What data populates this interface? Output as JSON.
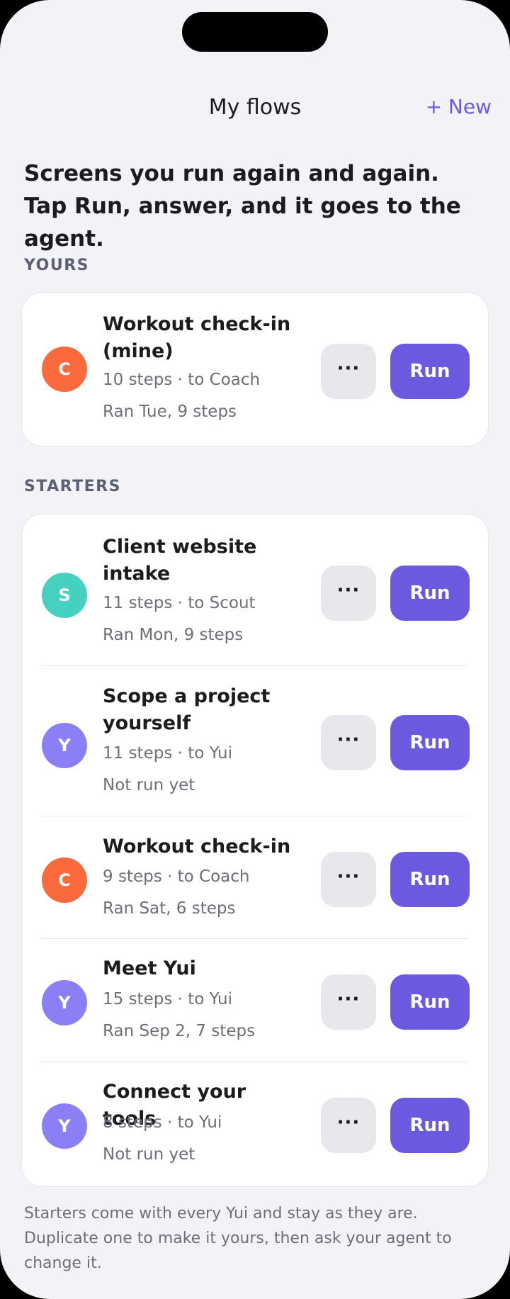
{
  "header": {
    "title": "My flows",
    "new_label": "+ New"
  },
  "intro": "Screens you run again and again. Tap Run, answer, and it goes to the agent.",
  "sections": {
    "yours": "YOURS",
    "starters": "STARTERS"
  },
  "yours_items": [
    {
      "initial": "C",
      "color": "#fa6a3c",
      "title": "Workout check-in (mine)",
      "steps": "10 steps · to Coach",
      "last_run": "Ran Tue, 9 steps",
      "more_icon": "···",
      "run_label": "Run"
    }
  ],
  "starter_items": [
    {
      "initial": "S",
      "color": "#45d0bf",
      "title": "Client website intake",
      "steps": "11 steps · to Scout",
      "last_run": "Ran Mon, 9 steps",
      "more_icon": "···",
      "run_label": "Run"
    },
    {
      "initial": "Y",
      "color": "#8b7ff5",
      "title": "Scope a project yourself",
      "steps": "11 steps · to Yui",
      "last_run": "Not run yet",
      "more_icon": "···",
      "run_label": "Run"
    },
    {
      "initial": "C",
      "color": "#fa6a3c",
      "title": "Workout check-in",
      "steps": "9 steps · to Coach",
      "last_run": "Ran Sat, 6 steps",
      "more_icon": "···",
      "run_label": "Run"
    },
    {
      "initial": "Y",
      "color": "#8b7ff5",
      "title": "Meet Yui",
      "steps": "15 steps · to Yui",
      "last_run": "Ran Sep 2, 7 steps",
      "more_icon": "···",
      "run_label": "Run"
    },
    {
      "initial": "Y",
      "color": "#8b7ff5",
      "title": "Connect your tools",
      "steps": "8 steps · to Yui",
      "last_run": "Not run yet",
      "more_icon": "···",
      "run_label": "Run"
    }
  ],
  "footer_note": "Starters come with every Yui and stay as they are. Duplicate one to make it yours, then ask your agent to change it.",
  "colors": {
    "accent": "#6b5ae0",
    "background": "#f3f2f7"
  }
}
